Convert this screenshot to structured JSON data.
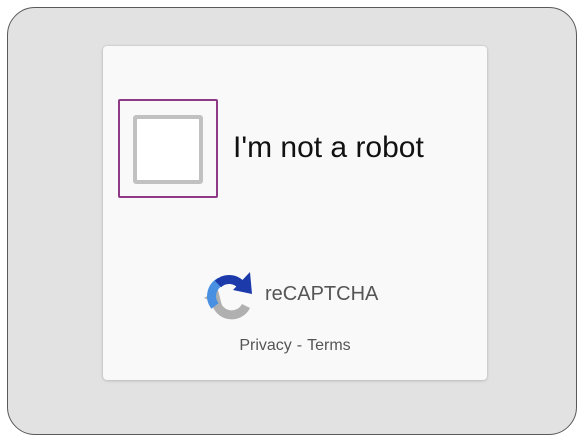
{
  "captcha": {
    "checkbox_label": "I'm not a robot",
    "checked": false,
    "brand": "reCAPTCHA",
    "brand_icon": "recaptcha-logo-icon",
    "links": {
      "privacy": "Privacy",
      "separator": "-",
      "terms": "Terms"
    }
  },
  "colors": {
    "focus_ring": "#8e3a86",
    "checkbox_border": "#c1c1c1",
    "logo_blue_dark": "#1c3aa9",
    "logo_blue": "#4a90e2",
    "logo_gray": "#b0b0b0"
  }
}
